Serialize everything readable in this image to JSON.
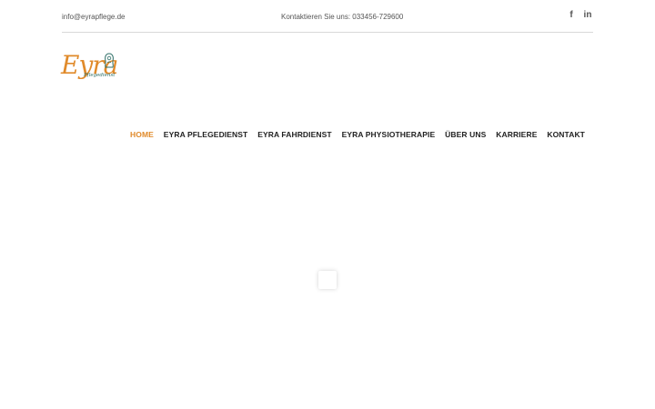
{
  "topbar": {
    "email": "info@eyrapflege.de",
    "contact": "Kontaktieren Sie uns:  033456-729600",
    "social": [
      {
        "icon": "facebook-icon",
        "glyph": "f"
      },
      {
        "icon": "linkedin-icon",
        "glyph": "in"
      }
    ]
  },
  "logo": {
    "word": "Eyra",
    "sub": "Pflegedienst"
  },
  "nav": {
    "items": [
      {
        "label": "HOME",
        "active": true
      },
      {
        "label": "EYRA PFLEGEDIENST",
        "active": false
      },
      {
        "label": "EYRA FAHRDIENST",
        "active": false
      },
      {
        "label": "EYRA PHYSIOTHERAPIE",
        "active": false
      },
      {
        "label": "ÜBER UNS",
        "active": false
      },
      {
        "label": "KARRIERE",
        "active": false
      },
      {
        "label": "KONTAKT",
        "active": false
      }
    ]
  },
  "colors": {
    "accent": "#e08a2a",
    "logo_green": "#2d6e66"
  }
}
